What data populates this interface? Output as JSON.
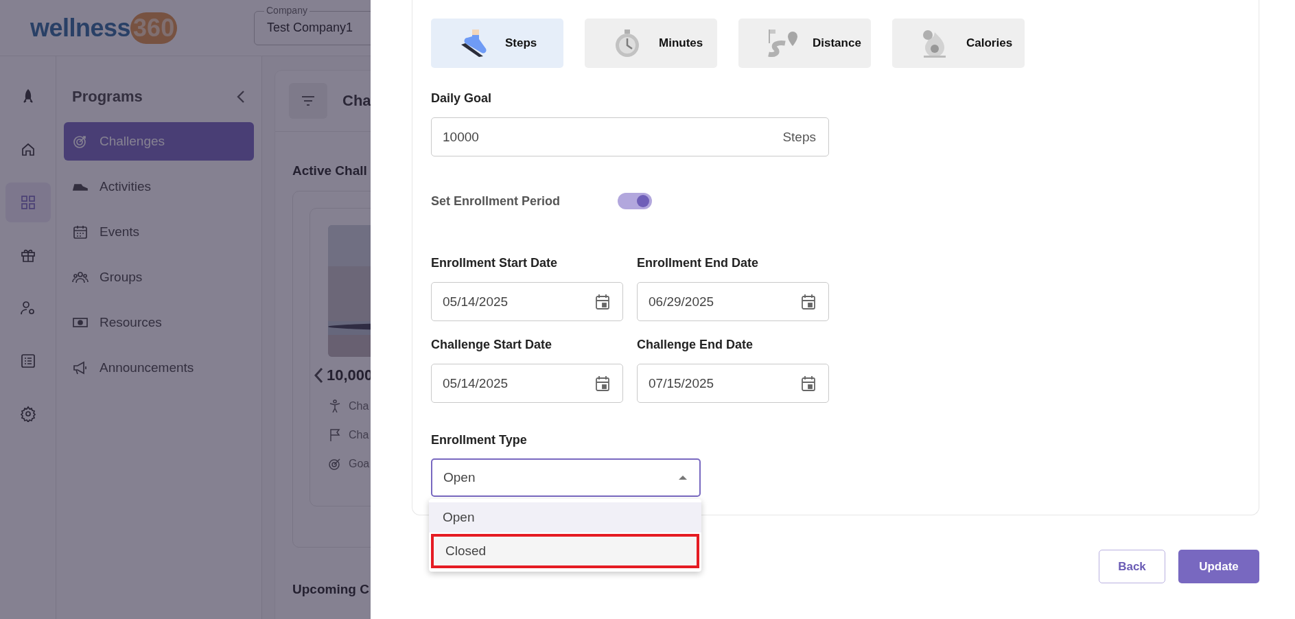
{
  "header": {
    "logo": {
      "word": "wellness",
      "number": "360"
    },
    "company_field": {
      "label": "Company",
      "value": "Test Company1"
    }
  },
  "rail": [
    {
      "kind": "rocket",
      "selected": false
    },
    {
      "kind": "home",
      "selected": false
    },
    {
      "kind": "grid",
      "selected": true
    },
    {
      "kind": "gift",
      "selected": false
    },
    {
      "kind": "user-gear",
      "selected": false
    },
    {
      "kind": "list",
      "selected": false
    },
    {
      "kind": "gear",
      "selected": false
    }
  ],
  "sidebar": {
    "title": "Programs",
    "items": [
      {
        "label": "Challenges",
        "kind": "target",
        "selected": true
      },
      {
        "label": "Activities",
        "kind": "shoe",
        "selected": false
      },
      {
        "label": "Events",
        "kind": "calendar",
        "selected": false
      },
      {
        "label": "Groups",
        "kind": "people",
        "selected": false
      },
      {
        "label": "Resources",
        "kind": "money",
        "selected": false
      },
      {
        "label": "Announcements",
        "kind": "megaphone",
        "selected": false
      }
    ]
  },
  "main": {
    "title": "Cha",
    "section": "Active Chall",
    "card": {
      "title": "10,000",
      "rows": [
        {
          "kind": "person",
          "text": "Cha"
        },
        {
          "kind": "flag",
          "text": "Cha"
        },
        {
          "kind": "target",
          "text": "Goa"
        }
      ]
    },
    "section_2": "Upcoming C"
  },
  "drawer": {
    "metrics": [
      {
        "label": "Steps",
        "kind": "steps",
        "selected": true
      },
      {
        "label": "Minutes",
        "kind": "minutes",
        "selected": false
      },
      {
        "label": "Distance",
        "kind": "distance",
        "selected": false
      },
      {
        "label": "Calories",
        "kind": "calories",
        "selected": false
      }
    ],
    "daily_goal": {
      "label": "Daily Goal",
      "value": "10000",
      "unit": "Steps"
    },
    "enrollment_period": {
      "label": "Set Enrollment Period",
      "on": true
    },
    "date_rows": [
      [
        {
          "label": "Enrollment Start Date",
          "value": "05/14/2025"
        },
        {
          "label": "Enrollment End Date",
          "value": "06/29/2025"
        }
      ],
      [
        {
          "label": "Challenge Start Date",
          "value": "05/14/2025"
        },
        {
          "label": "Challenge End Date",
          "value": "07/15/2025"
        }
      ]
    ],
    "enrollment_type": {
      "label": "Enrollment Type",
      "value": "Open",
      "expanded": true,
      "options": [
        {
          "label": "Open",
          "selected": true,
          "highlighted": false
        },
        {
          "label": "Closed",
          "selected": false,
          "highlighted": true
        }
      ]
    },
    "buttons": [
      {
        "label": "Back",
        "kind": "secondary"
      },
      {
        "label": "Update",
        "kind": "primary"
      }
    ]
  }
}
